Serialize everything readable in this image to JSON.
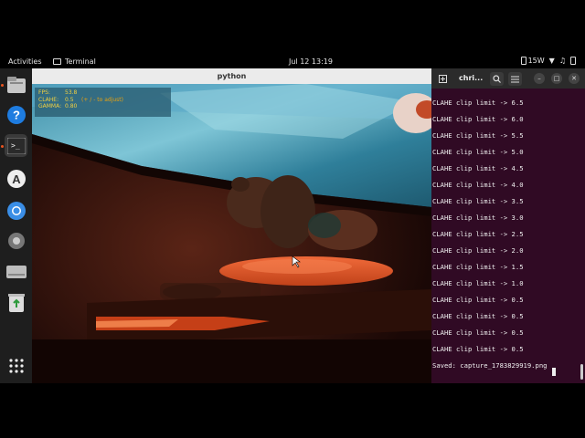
{
  "topbar": {
    "activities": "Activities",
    "app_name": "Terminal",
    "clock": "Jul 12  13:19",
    "power": "15W"
  },
  "dock": {
    "items": [
      "files-icon",
      "help-icon",
      "terminal-icon",
      "app-center-icon",
      "chromium-icon",
      "settings-icon",
      "drive-icon",
      "trash-icon",
      "app-grid-icon"
    ]
  },
  "python_window": {
    "title": "python",
    "overlay": {
      "fps_label": "FPS:",
      "fps_value": "53.8",
      "clahe_label": "CLAHE:",
      "clahe_value": "0.5",
      "clahe_hint": "(+ / - to adjust)",
      "gamma_label": "GAMMA:",
      "gamma_value": "0.80"
    }
  },
  "terminal": {
    "title": "chri...",
    "lines": [
      "CLAHE clip limit -> 6.5",
      "CLAHE clip limit -> 6.0",
      "CLAHE clip limit -> 5.5",
      "CLAHE clip limit -> 5.0",
      "CLAHE clip limit -> 4.5",
      "CLAHE clip limit -> 4.0",
      "CLAHE clip limit -> 3.5",
      "CLAHE clip limit -> 3.0",
      "CLAHE clip limit -> 2.5",
      "CLAHE clip limit -> 2.0",
      "CLAHE clip limit -> 1.5",
      "CLAHE clip limit -> 1.0",
      "CLAHE clip limit -> 0.5",
      "CLAHE clip limit -> 0.5",
      "CLAHE clip limit -> 0.5",
      "CLAHE clip limit -> 0.5",
      "Saved: capture_1783829919.png"
    ]
  }
}
